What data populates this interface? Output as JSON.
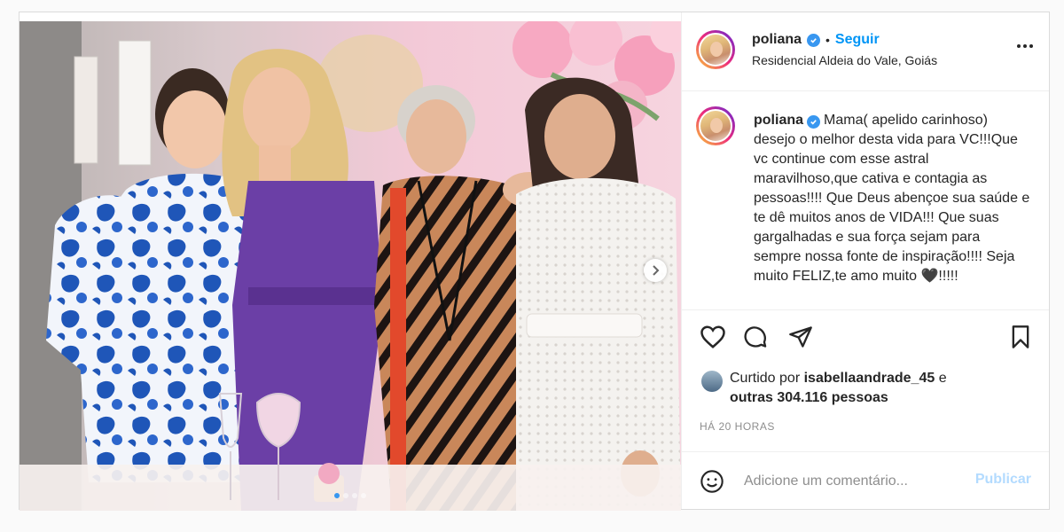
{
  "post": {
    "username": "poliana",
    "separator": "•",
    "follow_label": "Seguir",
    "location": "Residencial Aldeia do Vale, Goiás",
    "caption": "Mama( apelido carinhoso) desejo o melhor desta vida para VC!!!Que vc continue com esse astral maravilhoso,que cativa e contagia as pessoas!!!! Que Deus abençoe sua saúde e te dê muitos anos de VIDA!!! Que suas gargalhadas e sua força sejam para sempre nossa fonte de inspiração!!!! Seja muito FELIZ,te amo muito 🖤!!!!!",
    "likes_prefix": "Curtido por",
    "likes_user": "isabellaandrade_45",
    "likes_joiner": "e",
    "likes_others": "outras 304.116 pessoas",
    "time": "HÁ 20 HORAS",
    "comment_placeholder": "Adicione um comentário...",
    "publish_label": "Publicar",
    "carousel_dots": 4,
    "carousel_active": 1
  },
  "icons": {
    "verified": "verified-badge-icon",
    "more": "more-options-icon",
    "like": "heart-icon",
    "comment": "comment-icon",
    "share": "paper-plane-icon",
    "save": "bookmark-icon",
    "emoji": "emoji-icon",
    "next": "chevron-right-icon"
  },
  "colors": {
    "accent": "#0095f6",
    "verified": "#3897f0",
    "publish_disabled": "#b3dbff",
    "muted": "#8e8e8e"
  }
}
